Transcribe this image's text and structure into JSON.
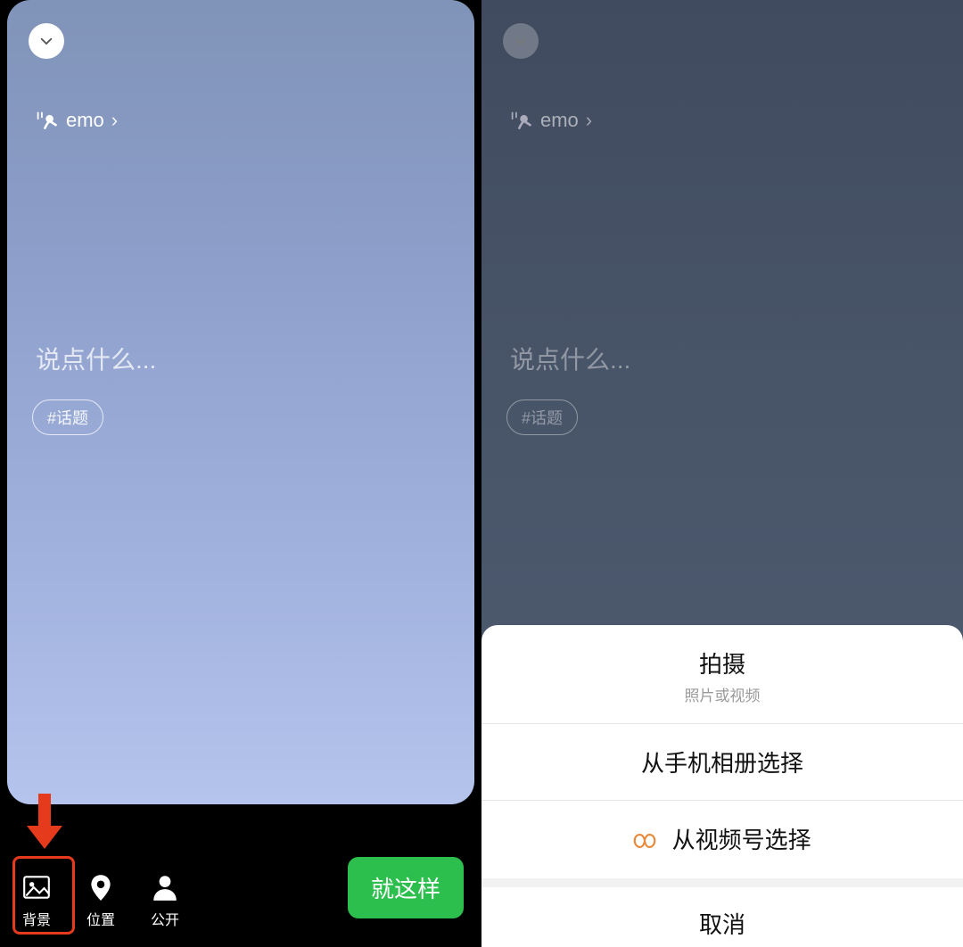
{
  "left": {
    "emo_label": "emo",
    "placeholder": "说点什么...",
    "topic_chip": "#话题",
    "toolbar": {
      "background": "背景",
      "location": "位置",
      "public": "公开",
      "submit": "就这样"
    }
  },
  "right": {
    "emo_label": "emo",
    "placeholder": "说点什么...",
    "topic_chip": "#话题",
    "sheet": {
      "shoot": "拍摄",
      "shoot_sub": "照片或视频",
      "from_album": "从手机相册选择",
      "from_channels": "从视频号选择",
      "cancel": "取消"
    }
  },
  "annotations": {
    "highlight_color": "#e63a1d"
  }
}
